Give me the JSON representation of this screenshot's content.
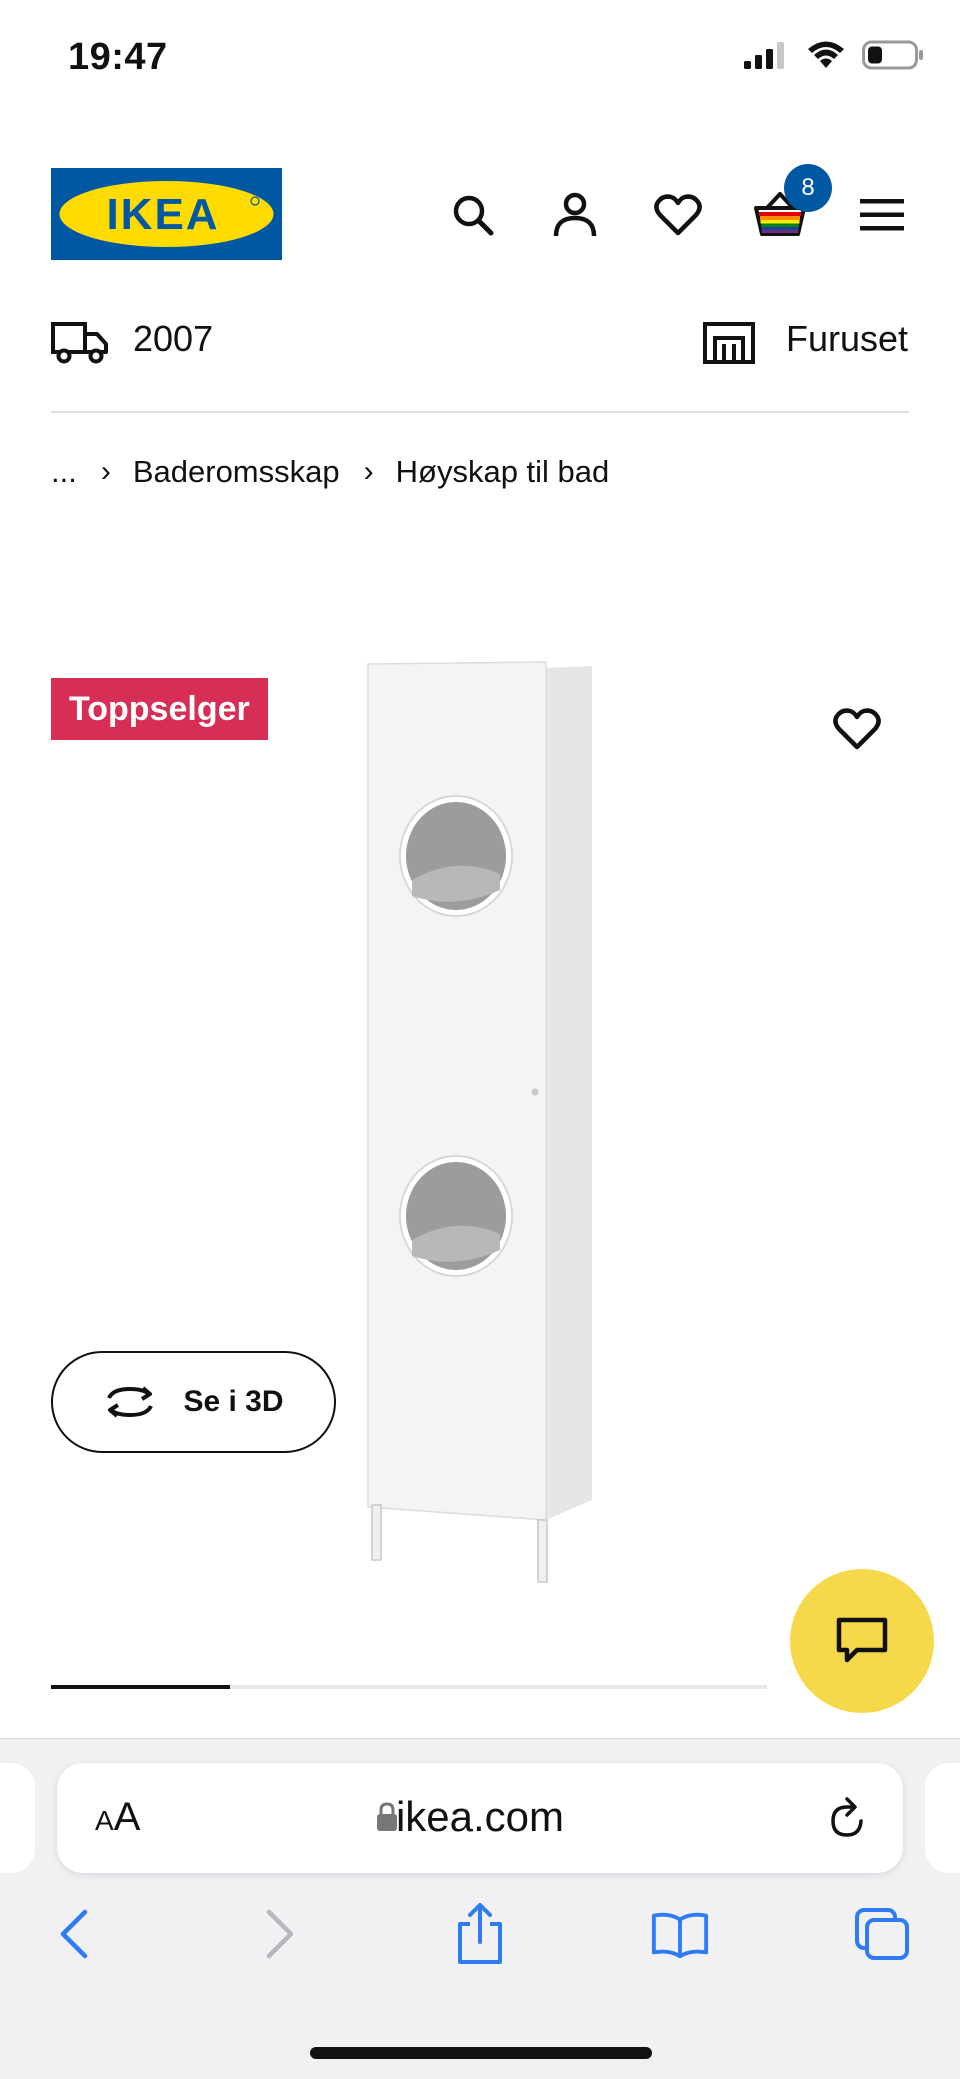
{
  "status_bar": {
    "time": "19:47"
  },
  "header": {
    "logo_text": "IKEA",
    "cart_count": "8",
    "brand_colors": {
      "blue": "#0058a3",
      "yellow": "#ffdb00"
    },
    "icons": [
      "search-icon",
      "profile-icon",
      "heart-icon",
      "cart-icon",
      "menu-icon"
    ]
  },
  "location": {
    "postal_code": "2007",
    "store": "Furuset"
  },
  "breadcrumb": {
    "items": [
      "...",
      "Baderomsskap",
      "Høyskap til bad"
    ]
  },
  "product": {
    "badge": "Toppselger",
    "badge_color": "#d62e54",
    "view3d_label": "Se i 3D",
    "gallery_progress": 0.25
  },
  "browser": {
    "aa_label_small": "A",
    "aa_label_large": "A",
    "url": "ikea.com"
  }
}
